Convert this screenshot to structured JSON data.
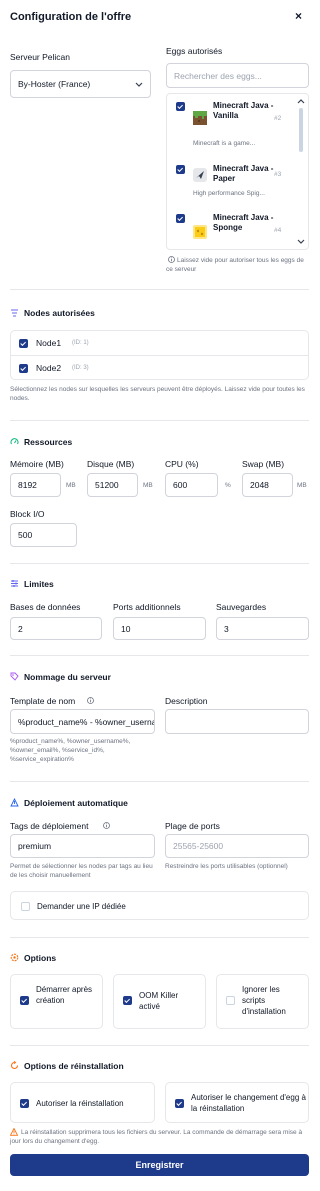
{
  "header": {
    "title": "Configuration de l'offre",
    "close_glyph": "×"
  },
  "server": {
    "label": "Serveur Pelican",
    "value": "By-Hoster (France)"
  },
  "eggs": {
    "label": "Eggs autorisés",
    "search_placeholder": "Rechercher des eggs...",
    "items": [
      {
        "name": "Minecraft Java - Vanilla",
        "num": "#2",
        "desc": "Minecraft is a game...",
        "icon": "minecraft-grass-icon",
        "checked": true
      },
      {
        "name": "Minecraft Java - Paper",
        "num": "#3",
        "desc": "High performance Spig...",
        "icon": "paper-icon",
        "checked": true
      },
      {
        "name": "Minecraft Java - Sponge",
        "num": "#4",
        "desc": "",
        "icon": "sponge-icon",
        "checked": true
      }
    ],
    "hint": "Laissez vide pour autoriser tous les eggs de ce serveur"
  },
  "nodes": {
    "title": "Nodes autorisées",
    "items": [
      {
        "name": "Node1",
        "id": "(ID: 1)",
        "checked": true
      },
      {
        "name": "Node2",
        "id": "(ID: 3)",
        "checked": true
      }
    ],
    "hint": "Sélectionnez les nodes sur lesquelles les serveurs peuvent être déployés. Laissez vide pour toutes les nodes."
  },
  "resources": {
    "title": "Ressources",
    "memory": {
      "label": "Mémoire (MB)",
      "value": "8192",
      "unit": "MB"
    },
    "disk": {
      "label": "Disque (MB)",
      "value": "51200",
      "unit": "MB"
    },
    "cpu": {
      "label": "CPU (%)",
      "value": "600",
      "unit": "%"
    },
    "swap": {
      "label": "Swap (MB)",
      "value": "2048",
      "unit": "MB"
    },
    "blockio": {
      "label": "Block I/O",
      "value": "500"
    }
  },
  "limits": {
    "title": "Limites",
    "databases": {
      "label": "Bases de données",
      "value": "2"
    },
    "ports": {
      "label": "Ports additionnels",
      "value": "10"
    },
    "backups": {
      "label": "Sauvegardes",
      "value": "3"
    }
  },
  "naming": {
    "title": "Nommage du serveur",
    "template": {
      "label": "Template de nom",
      "value": "%product_name% - %owner_username%"
    },
    "description": {
      "label": "Description",
      "value": ""
    },
    "hint": "%product_name%, %owner_username%, %owner_email%, %service_id%, %service_expiration%"
  },
  "deploy": {
    "title": "Déploiement automatique",
    "tags": {
      "label": "Tags de déploiement",
      "value": "premium",
      "hint": "Permet de sélectionner les nodes par tags au lieu de les choisir manuellement"
    },
    "ports": {
      "label": "Plage de ports",
      "placeholder": "25565-25600",
      "hint": "Restreindre les ports utilisables (optionnel)"
    },
    "dedicated_ip": {
      "label": "Demander une IP dédiée",
      "checked": false
    }
  },
  "options": {
    "title": "Options",
    "start_after": {
      "label": "Démarrer après création",
      "checked": true
    },
    "oom_killer": {
      "label": "OOM Killer activé",
      "checked": true
    },
    "skip_scripts": {
      "label": "Ignorer les scripts d'installation",
      "checked": false
    }
  },
  "reinstall": {
    "title": "Options de réinstallation",
    "allow": {
      "label": "Autoriser la réinstallation",
      "checked": true
    },
    "egg_change": {
      "label": "Autoriser le changement d'egg à la réinstallation",
      "checked": true
    },
    "warning": "La réinstallation supprimera tous les fichiers du serveur. La commande de démarrage sera mise à jour lors du changement d'egg."
  },
  "save_button": "Enregistrer",
  "colors": {
    "primary": "#1e3a8a",
    "icon_accent": "#6366f1",
    "warning": "#f97316"
  }
}
